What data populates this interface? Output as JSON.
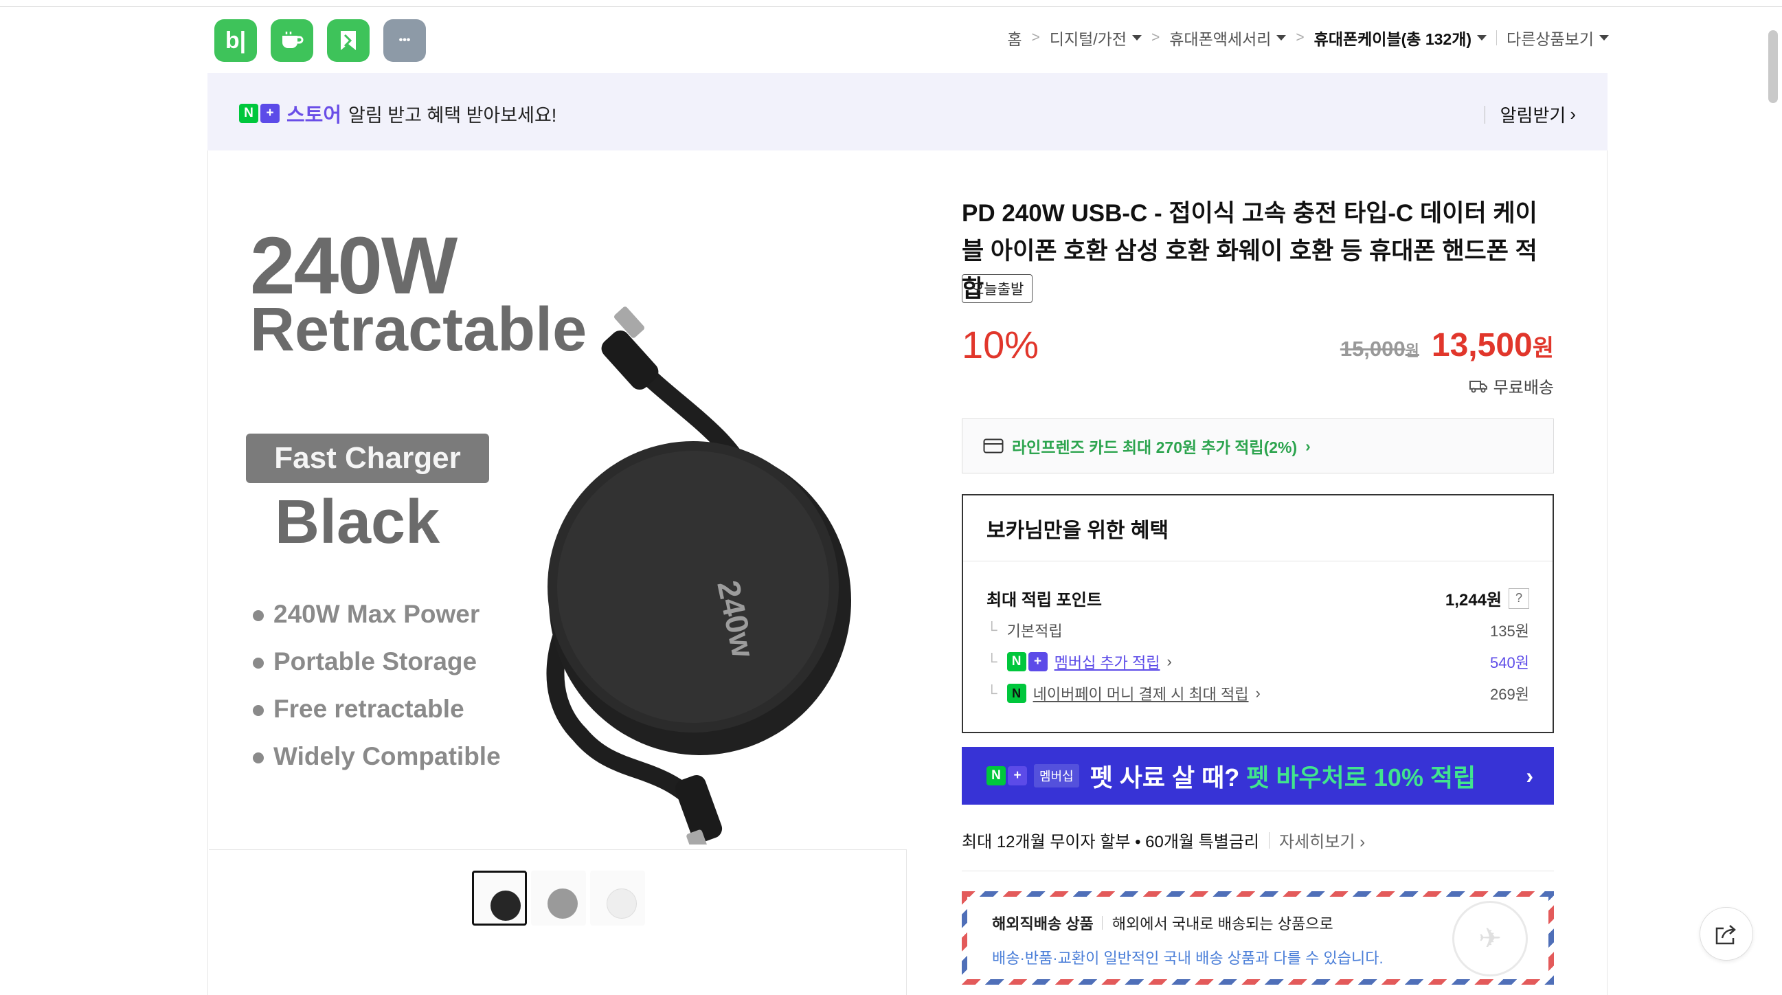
{
  "apps": [
    {
      "name": "blog",
      "glyph": "b|"
    },
    {
      "name": "cafe",
      "glyph": ""
    },
    {
      "name": "book",
      "glyph": ""
    },
    {
      "name": "more",
      "glyph": "•••"
    }
  ],
  "breadcrumb": {
    "home": "홈",
    "level1": "디지털/가전",
    "level2": "휴대폰액세서리",
    "level3": "휴대폰케이블(총 132개)",
    "other": "다른상품보기",
    "sep": ">"
  },
  "banner": {
    "n_glyph": "N",
    "plus_glyph": "+",
    "store": "스토어",
    "message": "알림 받고 혜택 받아보세요!",
    "action": "알림받기",
    "arrow": "›"
  },
  "photo": {
    "headline1": "240W",
    "headline2": "Retractable",
    "tag": "Fast Charger",
    "color": "Black",
    "features": [
      "240W Max Power",
      "Portable Storage",
      "Free retractable",
      "Widely Compatible"
    ],
    "device_label": "240w"
  },
  "product": {
    "title": "PD 240W USB-C - 접이식 고속 충전 타입-C 데이터 케이블 아이폰 호환 삼성 호환 화웨이 호환 등 휴대폰 핸드폰 적합",
    "badge": "오늘출발",
    "discount": "10%",
    "original_price": "15,000",
    "original_unit": "원",
    "sale_price": "13,500",
    "sale_unit": "원",
    "shipping": "무료배송"
  },
  "card_offer": {
    "text": "라인프렌즈 카드 최대 270원 추가 적립(2%)",
    "arrow": "›"
  },
  "benefits": {
    "title": "보카님만을 위한 혜택",
    "max_label": "최대 적립 포인트",
    "max_value": "1,244원",
    "help": "?",
    "rows": [
      {
        "label": "기본적립",
        "value": "135원"
      },
      {
        "label": "멤버십 추가 적립",
        "value": "540원"
      },
      {
        "label": "네이버페이 머니 결제 시 최대 적립",
        "value": "269원"
      }
    ],
    "tree": "└",
    "arrow": "›",
    "npay_glyph": "N"
  },
  "pet_banner": {
    "membership": "멤버십",
    "text1": "펫 사료 살 때?",
    "text2": "펫 바우처로 10% 적립",
    "arrow": "›"
  },
  "installment": {
    "text": "최대 12개월 무이자 할부 • 60개월 특별금리",
    "more": "자세히보기 ›"
  },
  "overseas": {
    "title": "해외직배송 상품",
    "desc": "해외에서 국내로 배송되는 상품으로",
    "note": "배송·반품·교환이 일반적인 국내 배송 상품과 다를 수 있습니다."
  },
  "colors": {
    "accent_red": "#e1362b",
    "naver_green": "#00c73c",
    "plus_purple": "#5c4be8",
    "pet_blue": "#3733d6"
  }
}
